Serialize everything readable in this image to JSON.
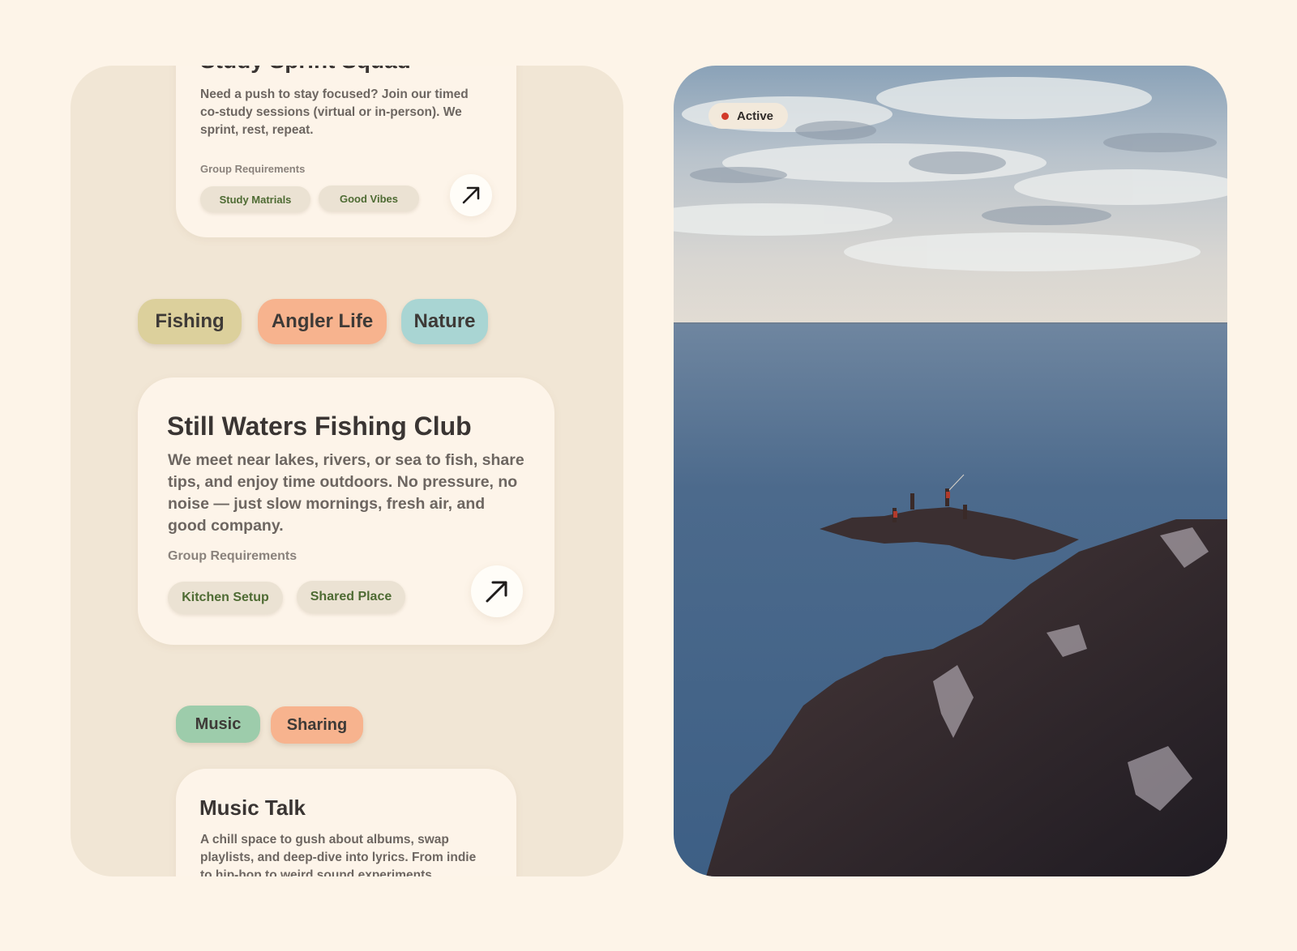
{
  "top_card": {
    "title": "Study Sprint Squad",
    "description": "Need a push to stay focused? Join our timed co-study sessions (virtual or in-person). We sprint, rest, repeat.",
    "requirements_label": "Group Requirements",
    "chips": [
      "Study Matrials",
      "Good Vibes"
    ],
    "arrow_icon": "arrow-up-right-icon"
  },
  "fishing_tags": [
    {
      "label": "Fishing",
      "color": "#dcd09c"
    },
    {
      "label": "Angler Life",
      "color": "#f7b38e"
    },
    {
      "label": "Nature",
      "color": "#a9d5d3"
    }
  ],
  "main_card": {
    "title": "Still Waters Fishing Club",
    "description": "We meet near lakes, rivers, or sea to fish, share tips, and enjoy time outdoors. No pressure, no noise — just slow mornings, fresh air, and good company.",
    "requirements_label": "Group Requirements",
    "chips": [
      "Kitchen Setup",
      "Shared Place"
    ],
    "arrow_icon": "arrow-up-right-icon"
  },
  "music_tags": [
    {
      "label": "Music",
      "color": "#9dccab"
    },
    {
      "label": "Sharing",
      "color": "#f7b38e"
    }
  ],
  "bottom_card": {
    "title": "Music Talk",
    "description": "A chill space to gush about albums, swap playlists, and deep-dive into lyrics. From indie to hip-hop to weird sound experiments."
  },
  "photo": {
    "status_label": "Active",
    "status_color": "#d23a2a",
    "image_icon": "coastal-fishing-photo"
  }
}
